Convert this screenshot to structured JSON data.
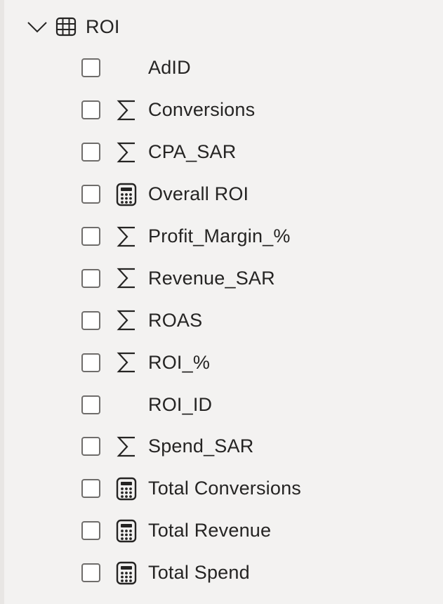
{
  "table": {
    "name": "ROI",
    "icon": "table-grid-icon",
    "expand_icon": "chevron-down-icon"
  },
  "fields": [
    {
      "label": "AdID",
      "icon": "none"
    },
    {
      "label": "Conversions",
      "icon": "sigma-icon"
    },
    {
      "label": "CPA_SAR",
      "icon": "sigma-icon"
    },
    {
      "label": "Overall ROI",
      "icon": "calculator-icon"
    },
    {
      "label": "Profit_Margin_%",
      "icon": "sigma-icon"
    },
    {
      "label": "Revenue_SAR",
      "icon": "sigma-icon"
    },
    {
      "label": "ROAS",
      "icon": "sigma-icon"
    },
    {
      "label": "ROI_%",
      "icon": "sigma-icon"
    },
    {
      "label": "ROI_ID",
      "icon": "none"
    },
    {
      "label": "Spend_SAR",
      "icon": "sigma-icon"
    },
    {
      "label": "Total Conversions",
      "icon": "calculator-icon"
    },
    {
      "label": "Total Revenue",
      "icon": "calculator-icon"
    },
    {
      "label": "Total Spend",
      "icon": "calculator-icon"
    }
  ],
  "colors": {
    "background": "#f3f2f1",
    "text": "#252423",
    "checkbox_border": "#6f6d6b"
  }
}
